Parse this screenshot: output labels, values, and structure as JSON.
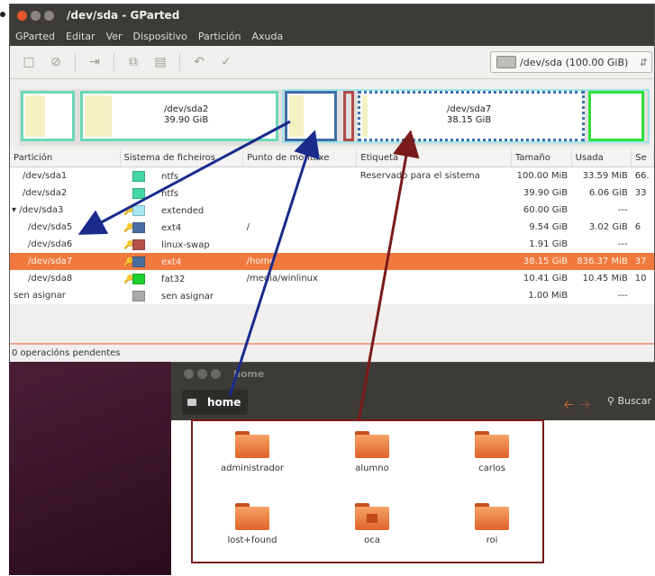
{
  "gparted": {
    "title": "/dev/sda - GParted",
    "menu": [
      "GParted",
      "Editar",
      "Ver",
      "Dispositivo",
      "Partición",
      "Axuda"
    ],
    "device_selector": "/dev/sda (100.00 GiB)",
    "partition_map": {
      "sda2": {
        "name": "/dev/sda2",
        "size": "39.90 GiB"
      },
      "sda7": {
        "name": "/dev/sda7",
        "size": "38.15 GiB"
      }
    },
    "columns": [
      "Partición",
      "Sistema de ficheiros",
      "Punto de montaxe",
      "Etiqueta",
      "Tamaño",
      "Usada",
      "Se"
    ],
    "rows": [
      {
        "partition": "/dev/sda1",
        "fs": "ntfs",
        "mount": "",
        "label": "Reservado para el sistema",
        "size": "100.00 MiB",
        "used": "33.59 MiB",
        "free": "66."
      },
      {
        "partition": "/dev/sda2",
        "fs": "ntfs",
        "mount": "",
        "label": "",
        "size": "39.90 GiB",
        "used": "6.06 GiB",
        "free": "33"
      },
      {
        "partition": "/dev/sda3",
        "fs": "extended",
        "mount": "",
        "label": "",
        "size": "60.00 GiB",
        "used": "---",
        "free": ""
      },
      {
        "partition": "/dev/sda5",
        "fs": "ext4",
        "mount": "/",
        "label": "",
        "size": "9.54 GiB",
        "used": "3.02 GiB",
        "free": "6"
      },
      {
        "partition": "/dev/sda6",
        "fs": "linux-swap",
        "mount": "",
        "label": "",
        "size": "1.91 GiB",
        "used": "---",
        "free": ""
      },
      {
        "partition": "/dev/sda7",
        "fs": "ext4",
        "mount": "/home",
        "label": "",
        "size": "38.15 GiB",
        "used": "836.37 MiB",
        "free": "37"
      },
      {
        "partition": "/dev/sda8",
        "fs": "fat32",
        "mount": "/media/winlinux",
        "label": "",
        "size": "10.41 GiB",
        "used": "10.45 MiB",
        "free": "10"
      },
      {
        "partition": "sen asignar",
        "fs": "sen asignar",
        "mount": "",
        "label": "",
        "size": "1.00 MiB",
        "used": "---",
        "free": ""
      }
    ],
    "fs_colors": {
      "ntfs": "#42d6a4",
      "extended": "#a6e6f0",
      "ext4": "#4a6ea0",
      "linux-swap": "#b5504a",
      "fat32": "#1fcf2f",
      "unallocated": "#a9a9a9"
    },
    "selected_row": "/dev/sda7",
    "pending": "0 operacións pendentes"
  },
  "nautilus": {
    "title": "home",
    "breadcrumb": "home",
    "search": "Buscar",
    "folders": [
      "administrador",
      "alumno",
      "carlos",
      "lost+found",
      "oca",
      "roi"
    ]
  },
  "annotations": {
    "arrow_colors": {
      "blue": "#1a2b8c",
      "red": "#7a1a1a"
    }
  }
}
